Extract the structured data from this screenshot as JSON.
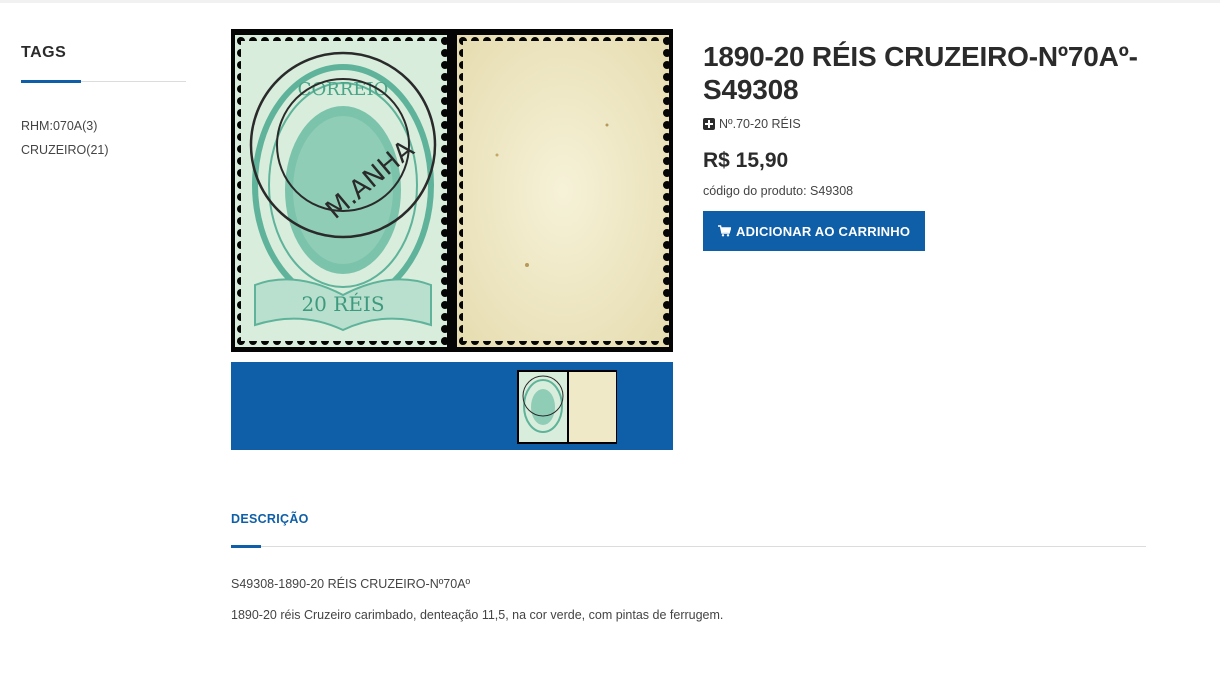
{
  "sidebar": {
    "heading": "TAGS",
    "tags": [
      {
        "label": "RHM:070A(3)"
      },
      {
        "label": "CRUZEIRO(21)"
      }
    ]
  },
  "gallery": {
    "stamp_front_text": {
      "top": "CORREIO",
      "value": "20 RÉIS",
      "postmark": "M.ANHA"
    }
  },
  "product": {
    "title": "1890-20 RÉIS CRUZEIRO-Nº70Aº-S49308",
    "category_icon": "plus-square-icon",
    "category": "Nº.70-20 RÉIS",
    "price": "R$ 15,90",
    "sku": "código do produto: S49308",
    "add_to_cart_icon": "shopping-cart-icon",
    "add_to_cart_label": "ADICIONAR AO CARRINHO"
  },
  "description": {
    "tab_label": "DESCRIÇÃO",
    "lines": [
      "S49308-1890-20 RÉIS CRUZEIRO-Nº70Aº",
      "1890-20 réis Cruzeiro carimbado, denteação 11,5, na cor verde, com pintas de ferrugem."
    ]
  },
  "colors": {
    "accent": "#0f5fa8",
    "text_dark": "#2b2b2b",
    "stamp_green": "#5fb39a",
    "stamp_paper": "#efe9c8"
  }
}
